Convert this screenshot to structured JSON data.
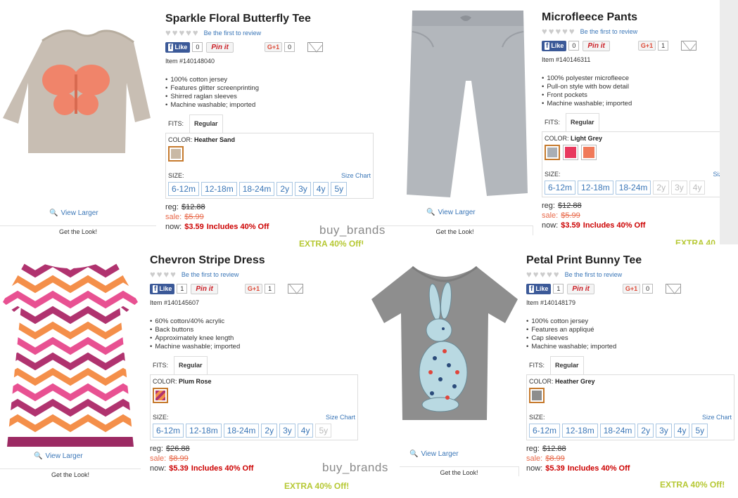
{
  "watermark": "buy_brands",
  "products": [
    {
      "title": "Sparkle Floral Butterfly Tee",
      "review": "Be the first to review",
      "fb_label": "Like",
      "fb_count": "0",
      "pin_label": "Pin it",
      "gplus_label": "G+1",
      "gplus_count": "0",
      "item": "Item #140148040",
      "features": [
        "100% cotton jersey",
        "Features glitter screenprinting",
        "Shirred raglan sleeves",
        "Machine washable; imported"
      ],
      "fits_label": "FITS:",
      "fit": "Regular",
      "color_label": "COLOR:",
      "color": "Heather Sand",
      "swatches": [
        "#c9b9a5"
      ],
      "size_label": "SIZE:",
      "size_chart": "Size Chart",
      "sizes": [
        "6-12m",
        "12-18m",
        "18-24m",
        "2y",
        "3y",
        "4y",
        "5y"
      ],
      "reg_label": "reg:",
      "reg": "$12.88",
      "sale_label": "sale:",
      "sale": "$5.99",
      "now_label": "now:",
      "now": "$3.59",
      "includes": "Includes 40% Off",
      "extra": "EXTRA 40% Off!",
      "view_larger": "View Larger",
      "get_look": "Get the Look!"
    },
    {
      "title": "Microfleece Pants",
      "review": "Be the first to review",
      "fb_label": "Like",
      "fb_count": "0",
      "pin_label": "Pin it",
      "gplus_label": "G+1",
      "gplus_count": "1",
      "item": "Item #140146311",
      "features": [
        "100% polyester microfleece",
        "Pull-on style with bow detail",
        "Front pockets",
        "Machine washable; imported"
      ],
      "fits_label": "FITS:",
      "fit": "Regular",
      "color_label": "COLOR:",
      "color": "Light Grey",
      "swatches": [
        "#a9aeb4",
        "#e8385d",
        "#f07a5a"
      ],
      "size_label": "SIZE:",
      "size_chart": "Siz",
      "sizes": [
        "6-12m",
        "12-18m",
        "18-24m",
        "2y",
        "3y",
        "4y"
      ],
      "reg_label": "reg:",
      "reg": "$12.88",
      "sale_label": "sale:",
      "sale": "$5.99",
      "now_label": "now:",
      "now": "$3.59",
      "includes": "Includes 40% Off",
      "extra": "EXTRA 40",
      "view_larger": "View Larger",
      "get_look": "Get the Look!"
    },
    {
      "title": "Chevron Stripe Dress",
      "review": "Be the first to review",
      "fb_label": "Like",
      "fb_count": "1",
      "pin_label": "Pin it",
      "gplus_label": "G+1",
      "gplus_count": "1",
      "item": "Item #140145607",
      "features": [
        "60% cotton/40% acrylic",
        "Back buttons",
        "Approximately knee length",
        "Machine washable; imported"
      ],
      "fits_label": "FITS:",
      "fit": "Regular",
      "color_label": "COLOR:",
      "color": "Plum Rose",
      "swatches": [
        "#b0336f"
      ],
      "size_label": "SIZE:",
      "size_chart": "Size Chart",
      "sizes": [
        "6-12m",
        "12-18m",
        "18-24m",
        "2y",
        "3y",
        "4y",
        "5y"
      ],
      "reg_label": "reg:",
      "reg": "$26.88",
      "sale_label": "sale:",
      "sale": "$8.99",
      "now_label": "now:",
      "now": "$5.39",
      "includes": "Includes 40% Off",
      "extra": "EXTRA 40% Off!",
      "view_larger": "View Larger",
      "get_look": "Get the Look!"
    },
    {
      "title": "Petal Print Bunny Tee",
      "review": "Be the first to review",
      "fb_label": "Like",
      "fb_count": "1",
      "pin_label": "Pin it",
      "gplus_label": "G+1",
      "gplus_count": "0",
      "item": "Item #140148179",
      "features": [
        "100% cotton jersey",
        "Features an appliqué",
        "Cap sleeves",
        "Machine washable; imported"
      ],
      "fits_label": "FITS:",
      "fit": "Regular",
      "color_label": "COLOR:",
      "color": "Heather Grey",
      "swatches": [
        "#8d8d8d"
      ],
      "size_label": "SIZE:",
      "size_chart": "Size Chart",
      "sizes": [
        "6-12m",
        "12-18m",
        "18-24m",
        "2y",
        "3y",
        "4y",
        "5y"
      ],
      "reg_label": "reg:",
      "reg": "$12.88",
      "sale_label": "sale:",
      "sale": "$8.99",
      "now_label": "now:",
      "now": "$5.39",
      "includes": "Includes 40% Off",
      "extra": "EXTRA 40% Off!",
      "view_larger": "View Larger",
      "get_look": "Get the Look!"
    }
  ]
}
